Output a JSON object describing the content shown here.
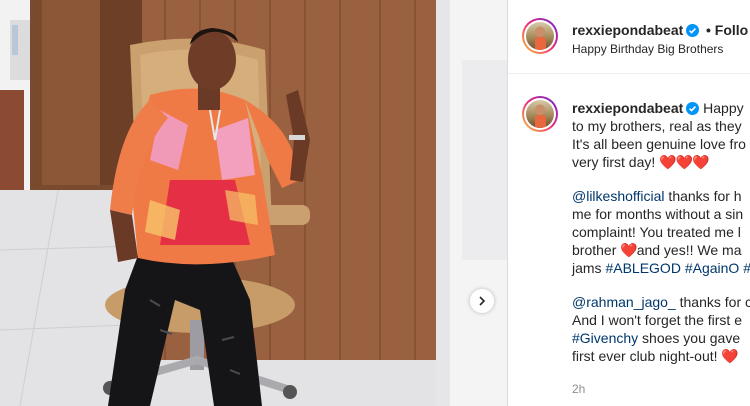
{
  "post": {
    "username": "rexxiepondabeat",
    "follow_label": "• Follo",
    "location_text": "Happy Birthday Big Brothers",
    "caption": {
      "intro": [
        "Happy",
        "to my brothers, real as they",
        "It's all been genuine love fro",
        "very first day!"
      ],
      "intro_hearts": "❤️❤️❤️",
      "p2_mention": "@lilkeshofficial",
      "p2_line1": " thanks for h",
      "p2_lines": [
        "me for months without a sin",
        "complaint! You treated me l"
      ],
      "p2_line4_text": "brother ",
      "p2_line4_heart": "❤️",
      "p2_line4_rest": "and yes!! We ma",
      "p2_line5_prefix": "jams ",
      "p2_tags": [
        "#ABLEGOD",
        "#AgainO",
        "#"
      ],
      "p3_mention": "@rahman_jago_",
      "p3_line1": " thanks for c",
      "p3_line2": "And I won't forget the first e",
      "p3_tag": "#Givenchy",
      "p3_line3": " shoes you gave",
      "p3_line4": "first ever club night-out! ",
      "p3_heart": "❤️"
    },
    "time_ago": "2h"
  },
  "icons": {
    "verified": "verified-badge-icon",
    "next": "chevron-right-icon"
  },
  "colors": {
    "link": "#00376b",
    "verified": "#0095f6",
    "heart": "#ed4956",
    "muted": "#8e8e8e"
  }
}
